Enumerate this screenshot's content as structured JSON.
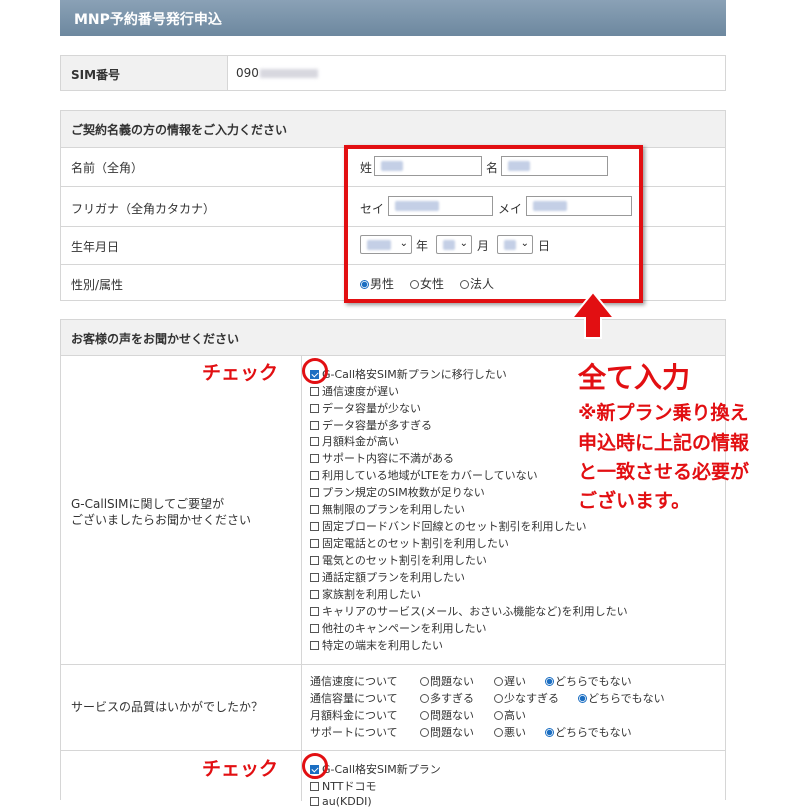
{
  "header": {
    "title": "MNP予約番号発行申込"
  },
  "sim": {
    "label": "SIM番号",
    "value": "090"
  },
  "contract": {
    "section_title": "ご契約名義の方の情報をご入力ください",
    "name": {
      "label": "名前（全角）",
      "sei_label": "姓",
      "mei_label": "名"
    },
    "kana": {
      "label": "フリガナ（全角カタカナ）",
      "sei_label": "セイ",
      "mei_label": "メイ"
    },
    "birth": {
      "label": "生年月日",
      "year_unit": "年",
      "month_unit": "月",
      "day_unit": "日"
    },
    "gender": {
      "label": "性別/属性",
      "options": [
        "男性",
        "女性",
        "法人"
      ],
      "selected": "男性"
    }
  },
  "voice": {
    "section_title": "お客様の声をお聞かせください",
    "request_label_line1": "G-CallSIMに関してご要望が",
    "request_label_line2": "ございましたらお聞かせください",
    "requests": [
      "G-Call格安SIM新プランに移行したい",
      "通信速度が遅い",
      "データ容量が少ない",
      "データ容量が多すぎる",
      "月額料金が高い",
      "サポート内容に不満がある",
      "利用している地域がLTEをカバーしていない",
      "プラン規定のSIM枚数が足りない",
      "無制限のプランを利用したい",
      "固定ブロードバンド回線とのセット割引を利用したい",
      "固定電話とのセット割引を利用したい",
      "電気とのセット割引を利用したい",
      "通話定額プランを利用したい",
      "家族割を利用したい",
      "キャリアのサービス(メール、おさいふ機能など)を利用したい",
      "他社のキャンペーンを利用したい",
      "特定の端末を利用したい"
    ],
    "quality_label": "サービスの品質はいかがでしたか？",
    "quality": [
      {
        "label": "通信速度について",
        "options": [
          "問題ない",
          "遅い",
          "どちらでもない"
        ]
      },
      {
        "label": "通信容量について",
        "options": [
          "多すぎる",
          "少なすぎる",
          "どちらでもない"
        ]
      },
      {
        "label": "月額料金について",
        "options": [
          "問題ない",
          "高い"
        ]
      },
      {
        "label": "サポートについて",
        "options": [
          "問題ない",
          "悪い",
          "どちらでもない"
        ]
      }
    ],
    "next_options": [
      "G-Call格安SIM新プラン",
      "NTTドコモ",
      "au(KDDI)"
    ]
  },
  "annotations": {
    "check": "チェック",
    "all_input": "全て入力",
    "note_lines": [
      "※新プラン乗り換え",
      "申込時に上記の情報",
      "と一致させる必要が",
      "ございます。"
    ],
    "color": "#e20f12"
  }
}
